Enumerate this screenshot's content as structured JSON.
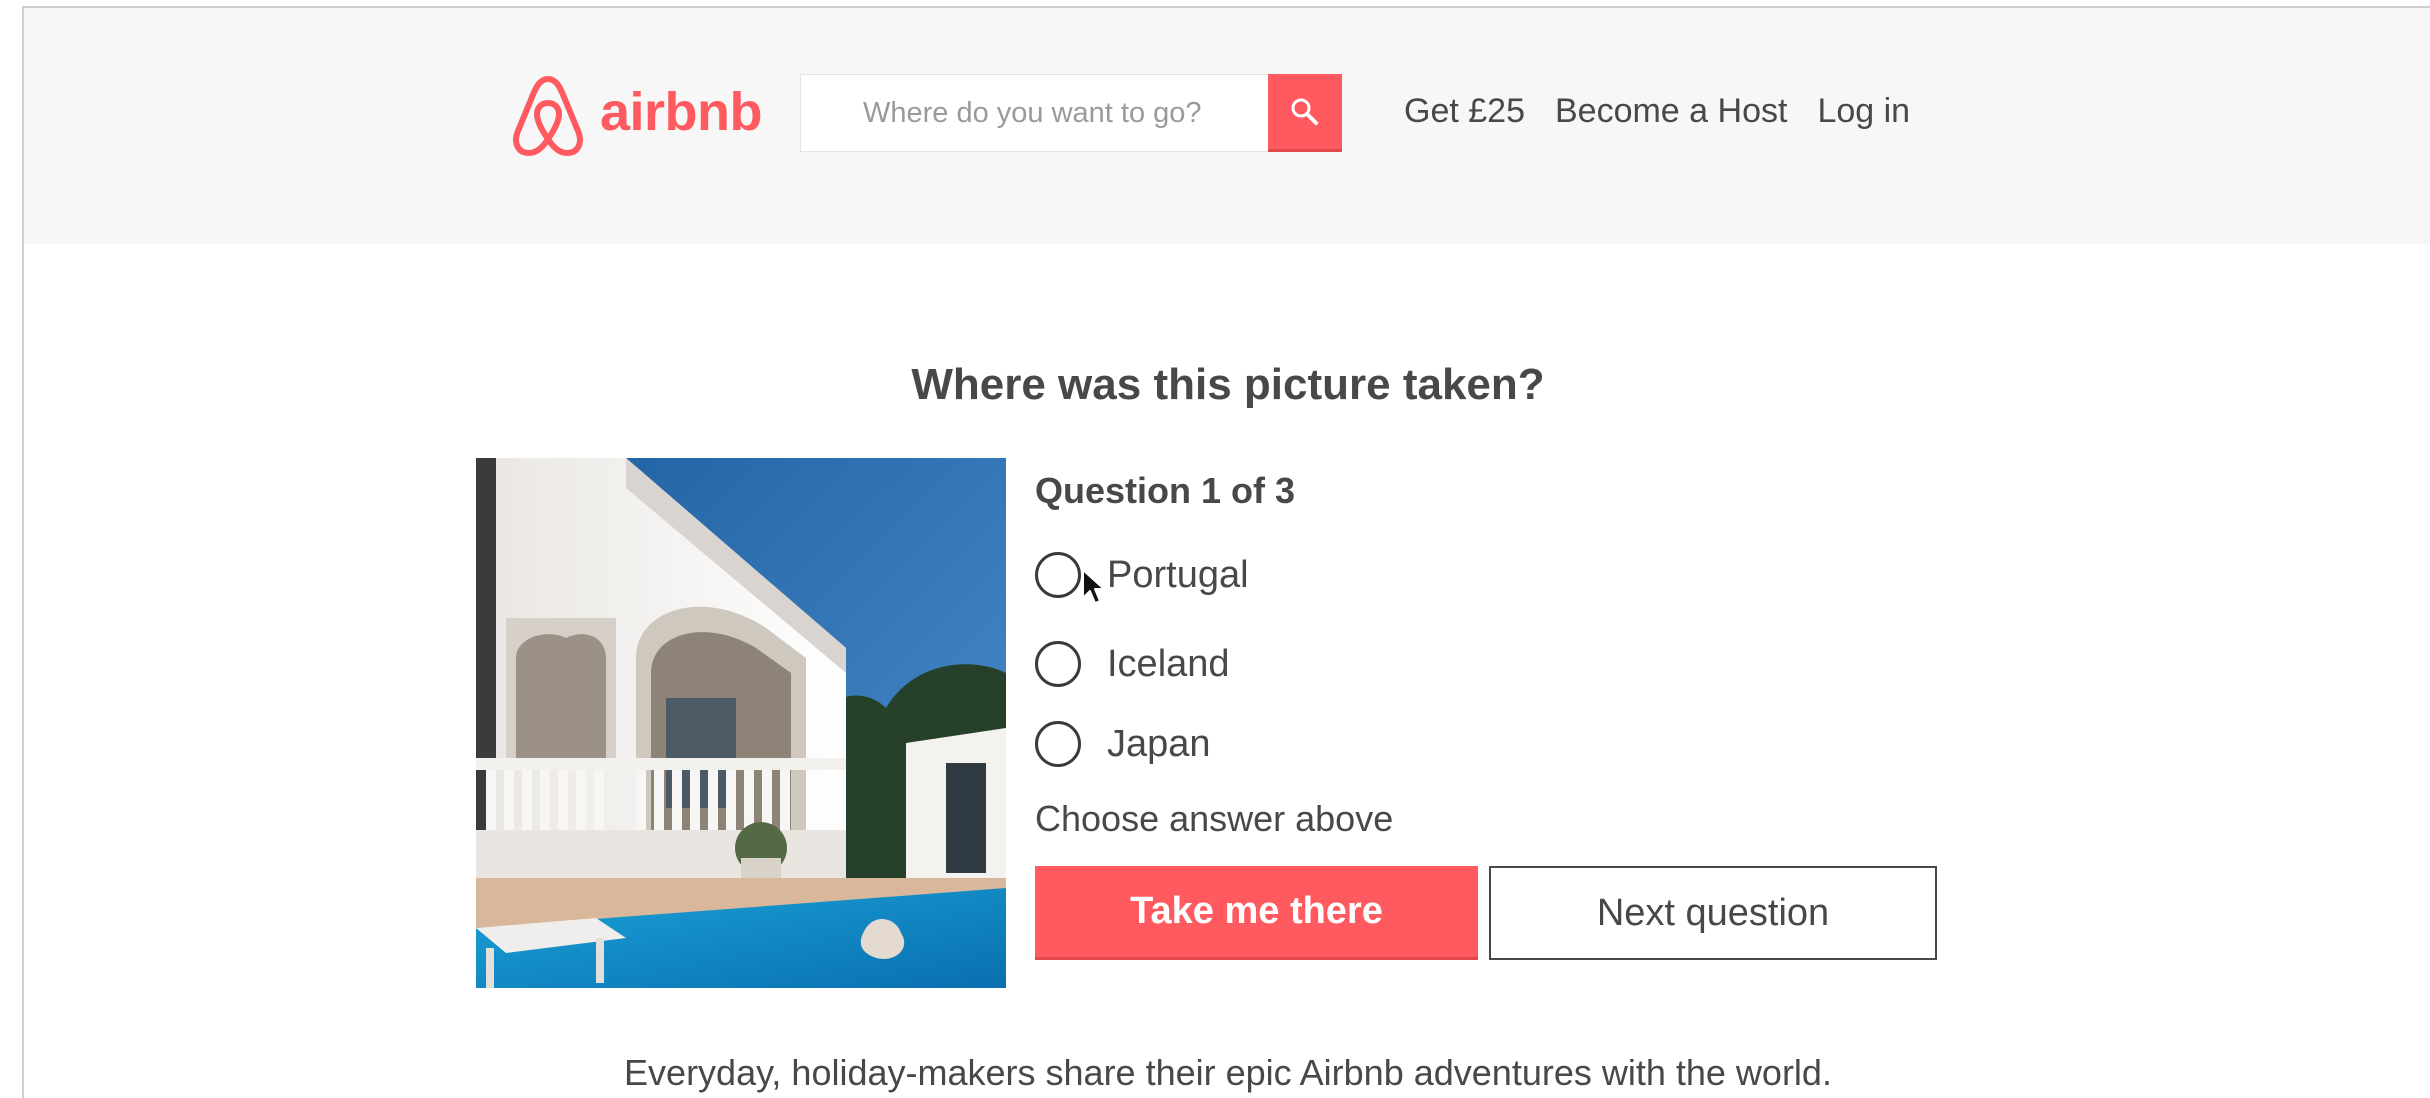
{
  "brand": {
    "name": "airbnb",
    "accent_color": "#ff5a5f"
  },
  "header": {
    "search_placeholder": "Where do you want to go?",
    "search_icon": "search-icon",
    "nav": [
      {
        "label": "Get £25"
      },
      {
        "label": "Become a Host"
      },
      {
        "label": "Log in"
      }
    ]
  },
  "quiz": {
    "title": "Where was this picture taken?",
    "question_count": "Question 1 of 3",
    "options": [
      {
        "label": "Portugal",
        "selected": false
      },
      {
        "label": "Iceland",
        "selected": false
      },
      {
        "label": "Japan",
        "selected": false
      }
    ],
    "hint": "Choose answer above",
    "primary_button": "Take me there",
    "secondary_button": "Next question"
  },
  "footer": {
    "text": "Everyday, holiday-makers share their epic Airbnb adventures with the world."
  }
}
